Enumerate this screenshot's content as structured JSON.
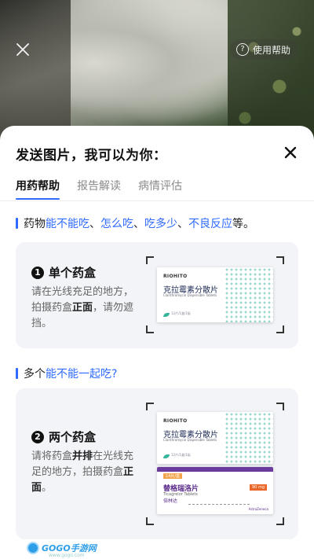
{
  "camera": {
    "help_label": "使用帮助"
  },
  "sheet": {
    "title": "发送图片，我可以为你：",
    "tabs": [
      {
        "label": "用药帮助",
        "active": true
      },
      {
        "label": "报告解读",
        "active": false
      },
      {
        "label": "病情评估",
        "active": false
      }
    ]
  },
  "section1": {
    "prefix": "药物",
    "hl1": "能不能吃",
    "sep1": "、",
    "hl2": "怎么吃",
    "sep2": "、",
    "hl3": "吃多少",
    "sep3": "、",
    "hl4": "不良反应",
    "suffix": "等。"
  },
  "card1": {
    "num": "1",
    "title": "单个药盒",
    "desc_a": "请在光线充足的地方，拍摄药盒",
    "desc_bold": "正面",
    "desc_b": "，请勿遮挡。",
    "box": {
      "brand": "RIOHITO",
      "name": "克拉霉素分散片",
      "sub": "Clarithromycin Dispersible Tablets",
      "spec": "12片/1盒/1板"
    }
  },
  "section2": {
    "prefix": "多个",
    "hl": "能不能一起吃?"
  },
  "card2": {
    "num": "2",
    "title": "两个药盒",
    "desc_a": "请将药盒",
    "desc_bold1": "并排",
    "desc_b": "在光线充足的地方，拍摄药盒",
    "desc_bold2": "正面",
    "desc_c": "。",
    "box_top": {
      "brand": "RIOHITO",
      "name": "克拉霉素分散片",
      "sub": "Clarithromycin Dispersible Tablets",
      "spec": "12片/1盒/1板"
    },
    "box_bottom": {
      "tag": "14片/盒",
      "name": "替格瑞洛片",
      "sub": "Ticagrelor Tablets",
      "cn": "倍林达",
      "dose": "90 mg",
      "maker": "AstraZeneca"
    }
  },
  "watermark": {
    "text": "GOGO手游网",
    "url": "www.gogo.com"
  },
  "colors": {
    "accent": "#2f6bff",
    "card_bg": "#f2f4f8"
  }
}
